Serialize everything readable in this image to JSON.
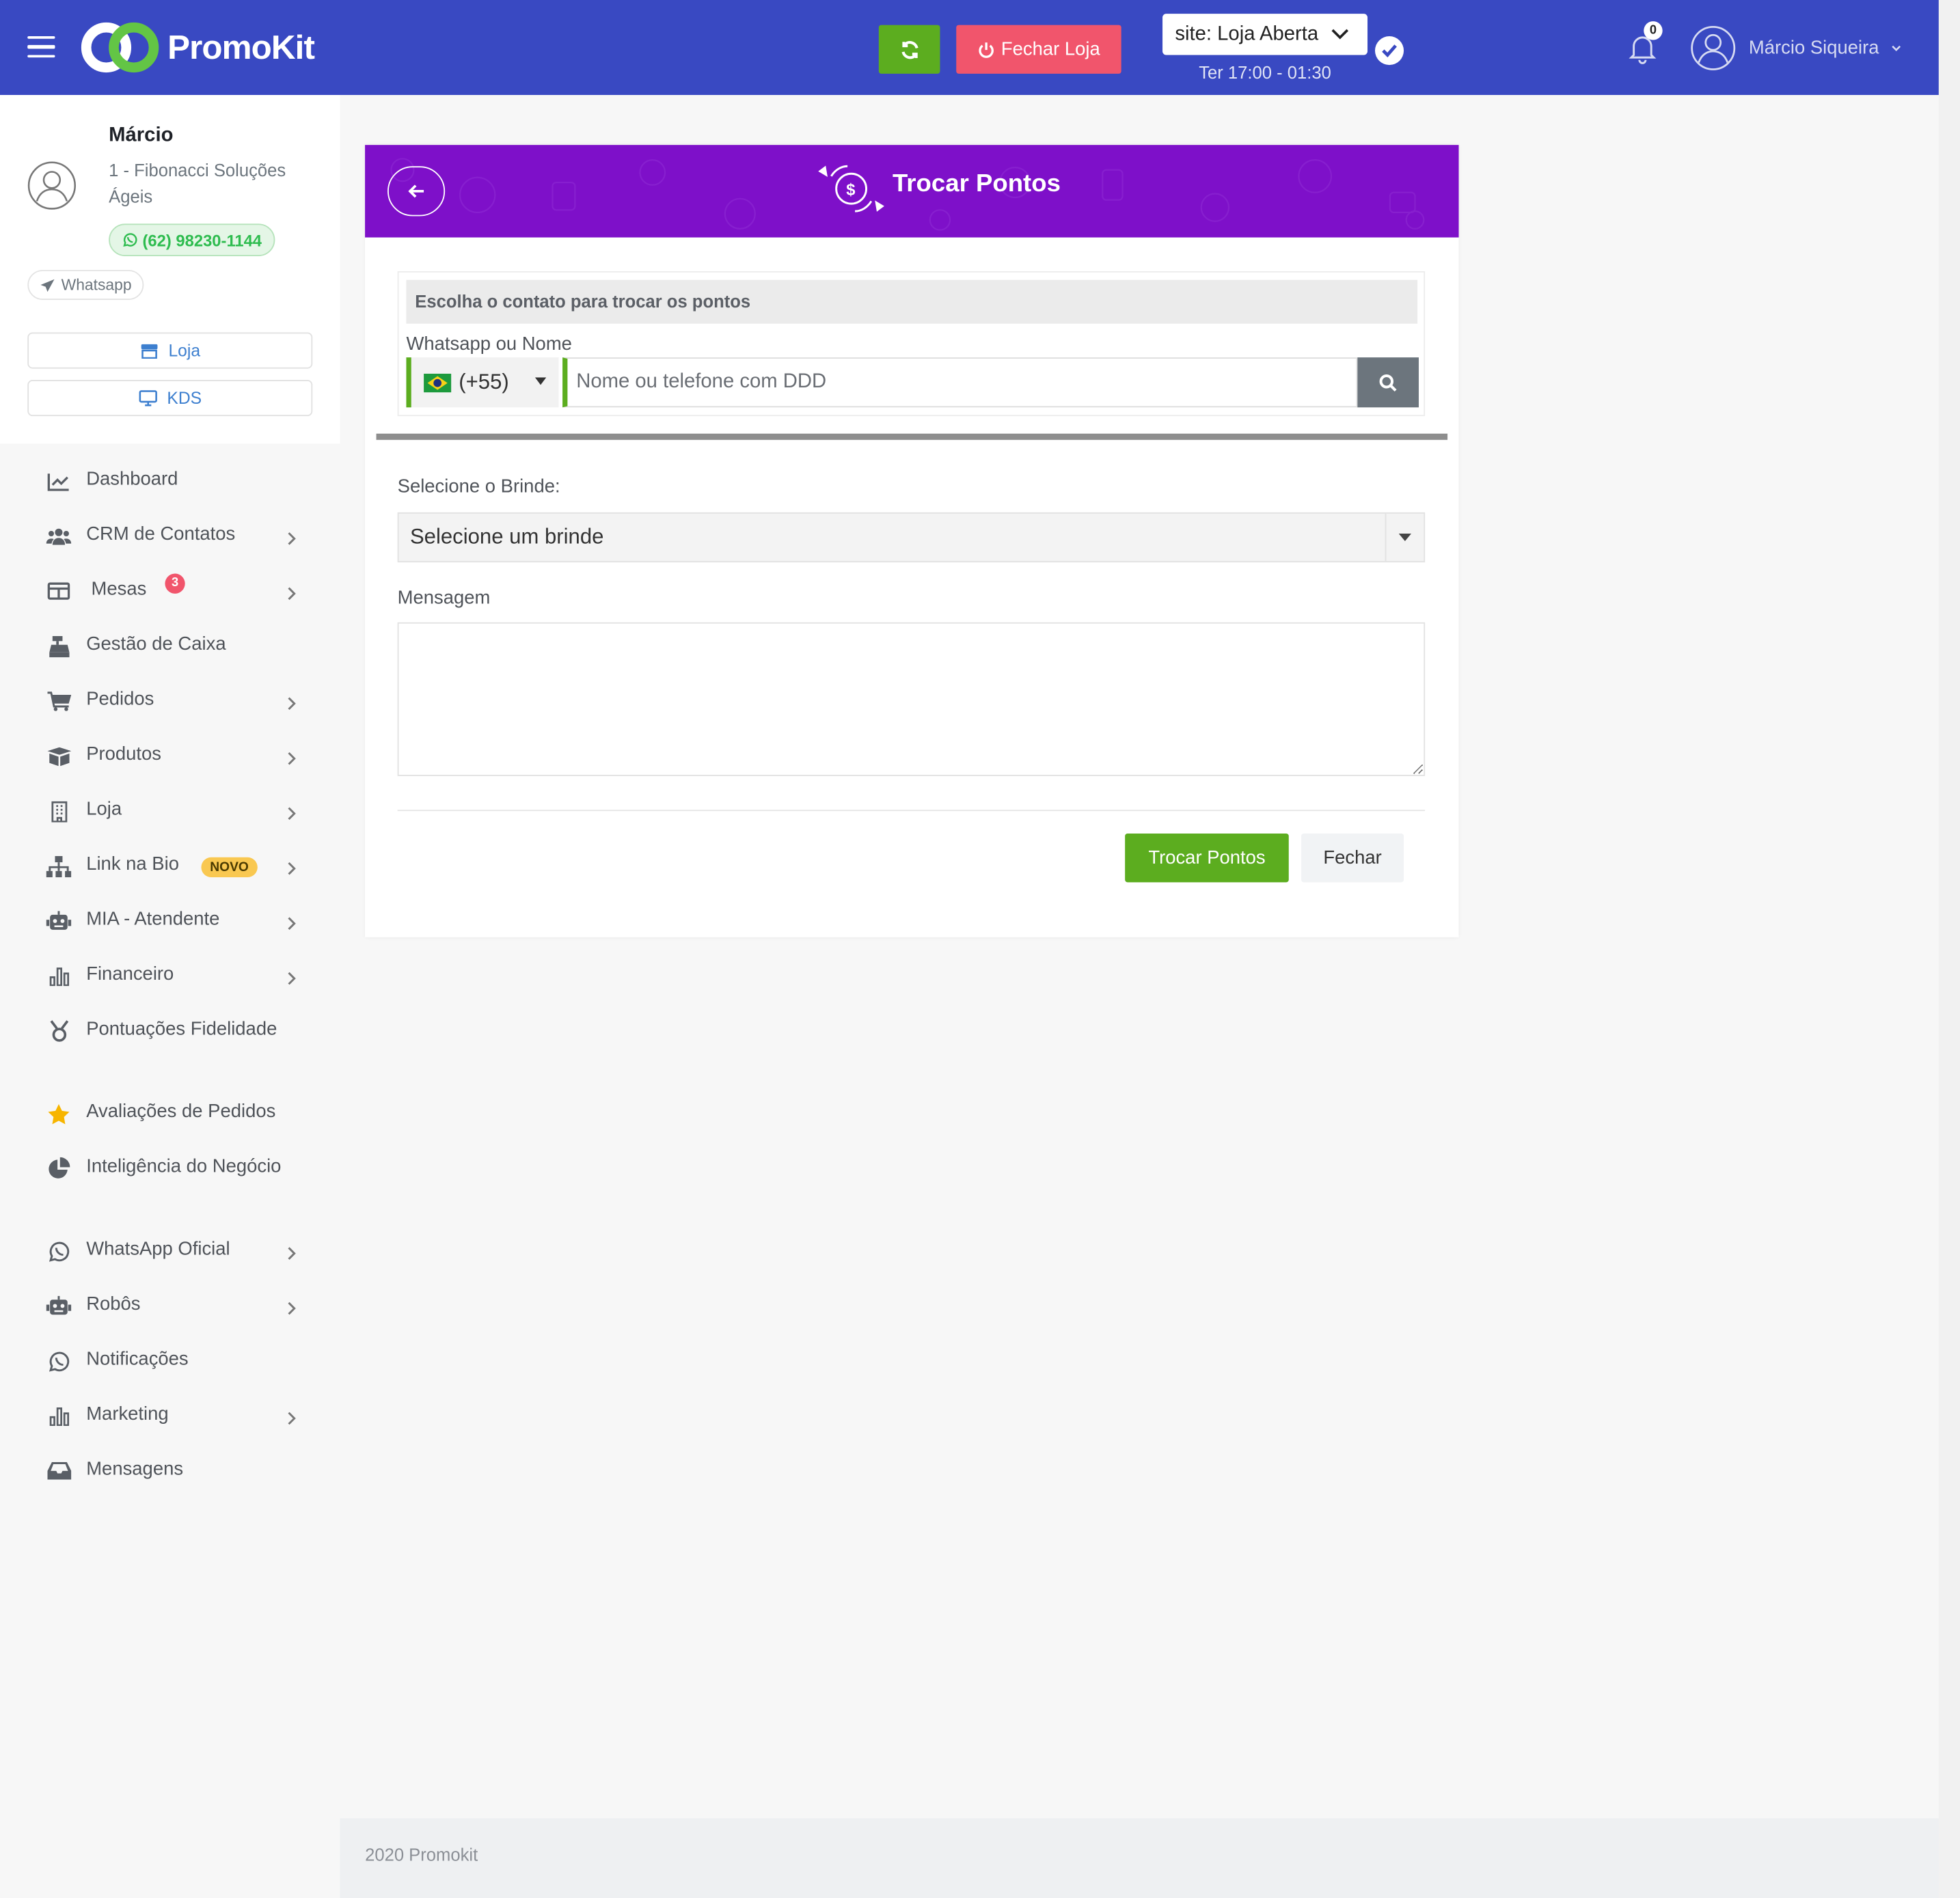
{
  "app": {
    "brand": "PromoKit"
  },
  "topbar": {
    "close_store_label": "Fechar Loja",
    "site_status": "site: Loja Aberta",
    "hours": "Ter 17:00 - 01:30",
    "notifications_count": "0",
    "user_name": "Márcio Siqueira"
  },
  "profile": {
    "name": "Márcio",
    "company": "1 - Fibonacci Soluções Ágeis",
    "phone": "(62) 98230-1144",
    "channel": "Whatsapp",
    "btn_loja": "Loja",
    "btn_kds": "KDS"
  },
  "menu": {
    "items": [
      {
        "label": "Dashboard",
        "icon": "chart-line-icon"
      },
      {
        "label": "CRM de Contatos",
        "icon": "users-icon"
      },
      {
        "label": "Mesas",
        "icon": "table-icon",
        "badge": "3"
      },
      {
        "label": "Gestão de Caixa",
        "icon": "cash-register-icon"
      },
      {
        "label": "Pedidos",
        "icon": "cart-icon"
      },
      {
        "label": "Produtos",
        "icon": "box-icon"
      },
      {
        "label": "Loja",
        "icon": "building-icon"
      },
      {
        "label": "Link na Bio",
        "icon": "sitemap-icon",
        "badge": "NOVO"
      },
      {
        "label": "MIA - Atendente",
        "icon": "robot-icon"
      },
      {
        "label": "Financeiro",
        "icon": "bar-chart-icon"
      },
      {
        "label": "Pontuações Fidelidade",
        "icon": "medal-icon"
      },
      {
        "label": "Avaliações de Pedidos",
        "icon": "star-icon"
      },
      {
        "label": "Inteligência do Negócio",
        "icon": "pie-chart-icon"
      },
      {
        "label": "WhatsApp Oficial",
        "icon": "whatsapp-icon"
      },
      {
        "label": "Robôs",
        "icon": "robot-icon"
      },
      {
        "label": "Notificações",
        "icon": "whatsapp-icon"
      },
      {
        "label": "Marketing",
        "icon": "bar-chart-icon"
      },
      {
        "label": "Mensagens",
        "icon": "inbox-icon"
      }
    ]
  },
  "card": {
    "title": "Trocar Pontos",
    "contact_header": "Escolha o contato para trocar os pontos",
    "contact_label": "Whatsapp ou Nome",
    "country_code": "(+55)",
    "search_placeholder": "Nome ou telefone com DDD",
    "brinde_label": "Selecione o Brinde:",
    "brinde_value": "Selecione um brinde",
    "message_label": "Mensagem",
    "message_value": "",
    "submit_label": "Trocar Pontos",
    "close_label": "Fechar"
  },
  "footer": {
    "text": "2020 Promokit"
  },
  "colors": {
    "topbar": "#3949c2",
    "card_header": "#7e10c9",
    "success": "#5cad1f",
    "danger": "#f1556c",
    "warning": "#f9c851"
  }
}
